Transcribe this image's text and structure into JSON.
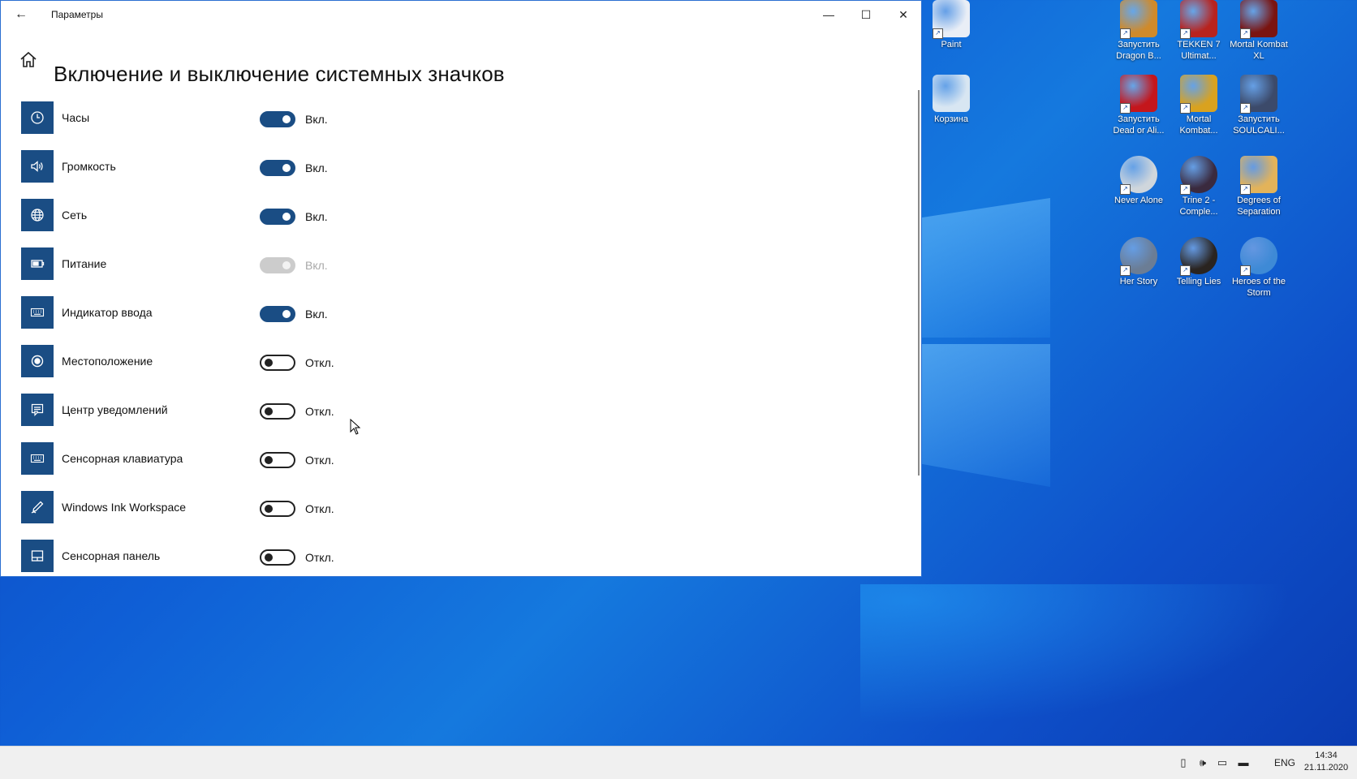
{
  "window": {
    "title": "Параметры",
    "back_label": "←",
    "minimize_label": "—",
    "maximize_label": "☐",
    "close_label": "✕"
  },
  "page": {
    "title": "Включение и выключение системных значков"
  },
  "settings": [
    {
      "label": "Часы",
      "state": "Вкл.",
      "on": true,
      "enabled": true,
      "icon": "clock-icon"
    },
    {
      "label": "Громкость",
      "state": "Вкл.",
      "on": true,
      "enabled": true,
      "icon": "volume-icon"
    },
    {
      "label": "Сеть",
      "state": "Вкл.",
      "on": true,
      "enabled": true,
      "icon": "globe-icon"
    },
    {
      "label": "Питание",
      "state": "Вкл.",
      "on": true,
      "enabled": false,
      "icon": "battery-icon"
    },
    {
      "label": "Индикатор ввода",
      "state": "Вкл.",
      "on": true,
      "enabled": true,
      "icon": "keyboard-icon"
    },
    {
      "label": "Местоположение",
      "state": "Откл.",
      "on": false,
      "enabled": true,
      "icon": "location-icon"
    },
    {
      "label": "Центр уведомлений",
      "state": "Откл.",
      "on": false,
      "enabled": true,
      "icon": "notification-icon"
    },
    {
      "label": "Сенсорная клавиатура",
      "state": "Откл.",
      "on": false,
      "enabled": true,
      "icon": "keyboard-icon"
    },
    {
      "label": "Windows Ink Workspace",
      "state": "Откл.",
      "on": false,
      "enabled": true,
      "icon": "pen-icon"
    },
    {
      "label": "Сенсорная панель",
      "state": "Откл.",
      "on": false,
      "enabled": true,
      "icon": "touchpad-icon"
    }
  ],
  "desktop_icons": [
    {
      "label": "Paint",
      "color": "#e9eef6"
    },
    {
      "label": "Корзина",
      "color": "#d8e6f2"
    },
    {
      "label": "Запустить Dragon B...",
      "color": "#d08a2a"
    },
    {
      "label": "TEKKEN 7 Ultimat...",
      "color": "#b8231e"
    },
    {
      "label": "Mortal Kombat XL",
      "color": "#7a1410"
    },
    {
      "label": "Запустить Dead or Ali...",
      "color": "#c4161c"
    },
    {
      "label": "Mortal Kombat...",
      "color": "#d9a21f"
    },
    {
      "label": "Запустить SOULCALI...",
      "color": "#3c4a6a"
    },
    {
      "label": "Never Alone",
      "color": "#cfd6dc"
    },
    {
      "label": "Trine 2 - Comple...",
      "color": "#3a2a3e"
    },
    {
      "label": "Degrees of Separation",
      "color": "#e3b35a"
    },
    {
      "label": "Her Story",
      "color": "#6b7d95"
    },
    {
      "label": "Telling Lies",
      "color": "#2a2420"
    },
    {
      "label": "Heroes of the Storm",
      "color": "#3e8ad6"
    }
  ],
  "taskbar": {
    "language": "ENG",
    "time": "14:34",
    "date": "21.11.2020"
  },
  "colors": {
    "accent": "#1a4d84",
    "desktop": "#0f5fd6"
  }
}
